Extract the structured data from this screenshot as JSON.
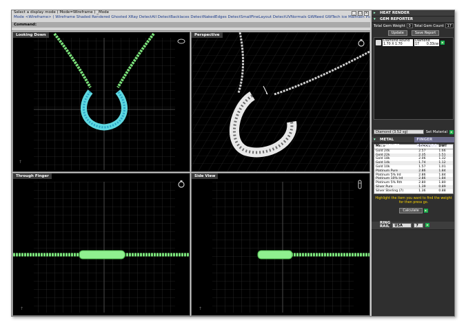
{
  "command_area": {
    "prompt": "Select a display mode ( Mode=Wireframe ) _Mode",
    "modes_line": "Mode <Wireframe> ( Wireframe  Shaded  Rendered  Ghosted  XRay  DetectAll  DetectBacklaces  DetectNakedEdges  DetectSmallFineLayout  DetectUVNormals  GWReed  GWTech  ice  Maintain  Plamo  Preview plus )",
    "command_label": "Command:"
  },
  "window_buttons": [
    "_",
    "□",
    "×"
  ],
  "viewports": [
    {
      "title": "Looking Down",
      "icon": "necklace-icon"
    },
    {
      "title": "Perspective",
      "icon": "ring-icon"
    },
    {
      "title": "Through Finger",
      "icon": "ring-icon"
    },
    {
      "title": "Side View",
      "icon": "ring-side-icon"
    }
  ],
  "sidebar": {
    "heat_render": {
      "title": "HEAT RENDER"
    },
    "gem_reporter": {
      "title": "GEM REPORTER",
      "total_gem_weight_label": "Total Gem Weight",
      "total_gem_weight_value": "0",
      "total_gem_count_label": "Total Gem Count",
      "total_gem_count_value": "17",
      "update_label": "Update",
      "save_report_label": "Save Report",
      "gem": {
        "name": "Diamond Round",
        "size": "1.70 X 1.70",
        "type": "Diamond",
        "count": "17",
        "carat": "0.33cw"
      }
    },
    "material": {
      "selected": "Diamond  (3.52 sg)",
      "set_button": "Set Material"
    },
    "metal_weights": {
      "title": "METAL WEIGHTS",
      "tab_label": "FINGER RECORDS",
      "headers": [
        "Metal",
        "Grams",
        "DWT"
      ],
      "rows": [
        [
          "Gold 24k",
          "2.57",
          "1.66"
        ],
        [
          "Gold 22k",
          "2.35",
          "1.51"
        ],
        [
          "Gold 18k",
          "2.06",
          "1.32"
        ],
        [
          "Gold 14k",
          "1.74",
          "1.12"
        ],
        [
          "Gold 10k",
          "1.57",
          "1.01"
        ],
        [
          "Platinum Pure",
          "2.86",
          "1.84"
        ],
        [
          "Platinum 5% Ird",
          "2.86",
          "1.84"
        ],
        [
          "Platinum 10% Ird",
          "2.86",
          "1.84"
        ],
        [
          "Platinum 5% Rth",
          "2.80",
          "1.80"
        ],
        [
          "Silver Pure",
          "1.39",
          "0.89"
        ],
        [
          "Silver Sterling (7)",
          "1.36",
          "0.88"
        ]
      ],
      "hint": "Highlight the item you want to find the weight for then press go.",
      "calculate_label": "Calculate"
    },
    "ring_rail": {
      "title_line1": "RING",
      "title_line2": "RAIL",
      "country": "USA",
      "size": "7"
    }
  }
}
